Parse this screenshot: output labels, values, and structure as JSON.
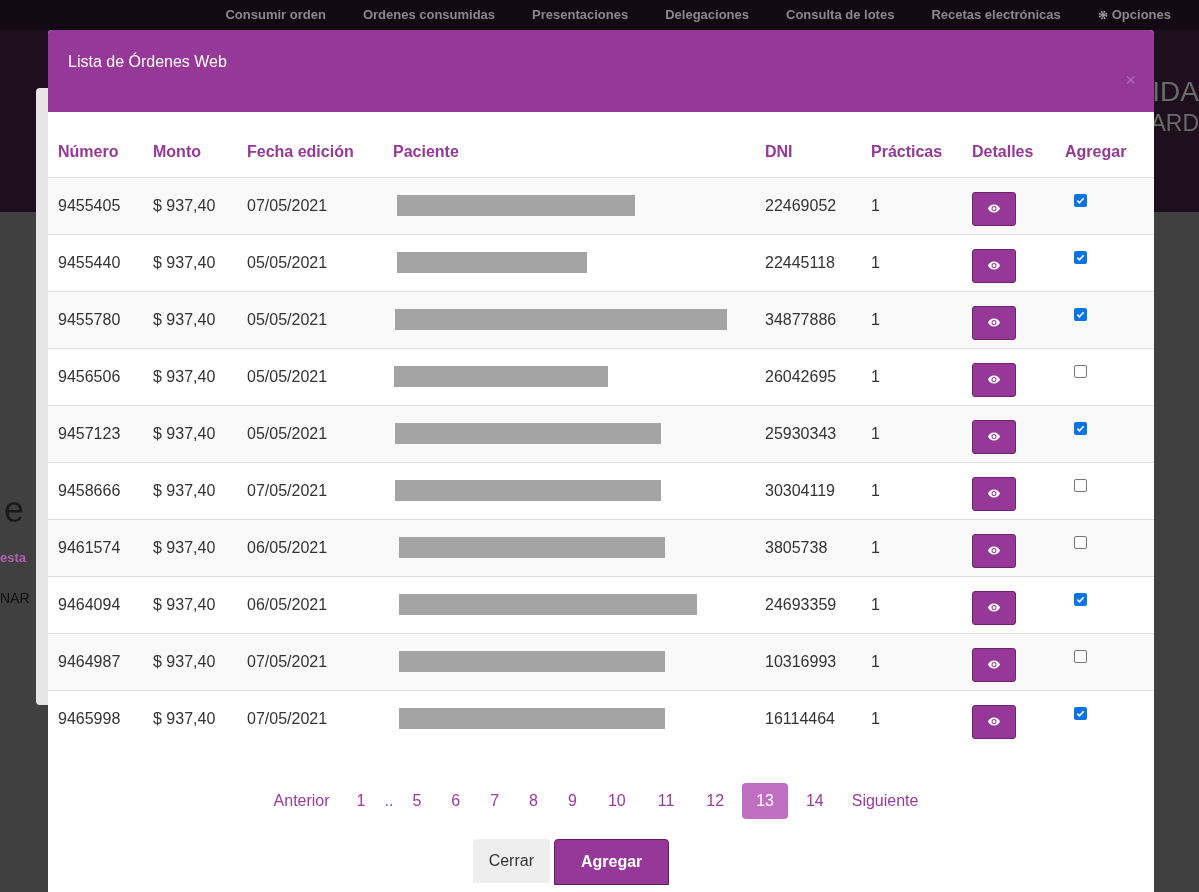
{
  "nav": [
    "Consumir orden",
    "Ordenes consumidas",
    "Presentaciones",
    "Delegaciones",
    "Consulta de lotes",
    "Recetas electrónicas",
    "Opciones"
  ],
  "background_fragments": {
    "heading_1": "IDA",
    "heading_2": "ARD",
    "big_letter": "e",
    "label": "esta",
    "value": "NAR"
  },
  "modal": {
    "title": "Lista de Órdenes Web",
    "close": "×",
    "columns": [
      "Número",
      "Monto",
      "Fecha edición",
      "Paciente",
      "DNI",
      "Prácticas",
      "Detalles",
      "Agregar"
    ],
    "rows": [
      {
        "numero": "9455405",
        "monto": "$ 937,40",
        "fecha": "07/05/2021",
        "dni": "22469052",
        "practicas": "1",
        "checked": true
      },
      {
        "numero": "9455440",
        "monto": "$ 937,40",
        "fecha": "05/05/2021",
        "dni": "22445118",
        "practicas": "1",
        "checked": true
      },
      {
        "numero": "9455780",
        "monto": "$ 937,40",
        "fecha": "05/05/2021",
        "dni": "34877886",
        "practicas": "1",
        "checked": true
      },
      {
        "numero": "9456506",
        "monto": "$ 937,40",
        "fecha": "05/05/2021",
        "dni": "26042695",
        "practicas": "1",
        "checked": false
      },
      {
        "numero": "9457123",
        "monto": "$ 937,40",
        "fecha": "05/05/2021",
        "dni": "25930343",
        "practicas": "1",
        "checked": true
      },
      {
        "numero": "9458666",
        "monto": "$ 937,40",
        "fecha": "07/05/2021",
        "dni": "30304119",
        "practicas": "1",
        "checked": false
      },
      {
        "numero": "9461574",
        "monto": "$ 937,40",
        "fecha": "06/05/2021",
        "dni": "3805738",
        "practicas": "1",
        "checked": false
      },
      {
        "numero": "9464094",
        "monto": "$ 937,40",
        "fecha": "06/05/2021",
        "dni": "24693359",
        "practicas": "1",
        "checked": true
      },
      {
        "numero": "9464987",
        "monto": "$ 937,40",
        "fecha": "07/05/2021",
        "dni": "10316993",
        "practicas": "1",
        "checked": false
      },
      {
        "numero": "9465998",
        "monto": "$ 937,40",
        "fecha": "07/05/2021",
        "dni": "16114464",
        "practicas": "1",
        "checked": true
      }
    ],
    "pagination": [
      {
        "label": "Anterior",
        "selected": false
      },
      {
        "label": "1",
        "selected": false
      },
      {
        "label": "..",
        "selected": false
      },
      {
        "label": "5",
        "selected": false
      },
      {
        "label": "6",
        "selected": false
      },
      {
        "label": "7",
        "selected": false
      },
      {
        "label": "8",
        "selected": false
      },
      {
        "label": "9",
        "selected": false
      },
      {
        "label": "10",
        "selected": false
      },
      {
        "label": "11",
        "selected": false
      },
      {
        "label": "12",
        "selected": false
      },
      {
        "label": "13",
        "selected": true
      },
      {
        "label": "14",
        "selected": false
      },
      {
        "label": "Siguiente",
        "selected": false
      }
    ],
    "buttons": {
      "close": "Cerrar",
      "add": "Agregar"
    }
  }
}
